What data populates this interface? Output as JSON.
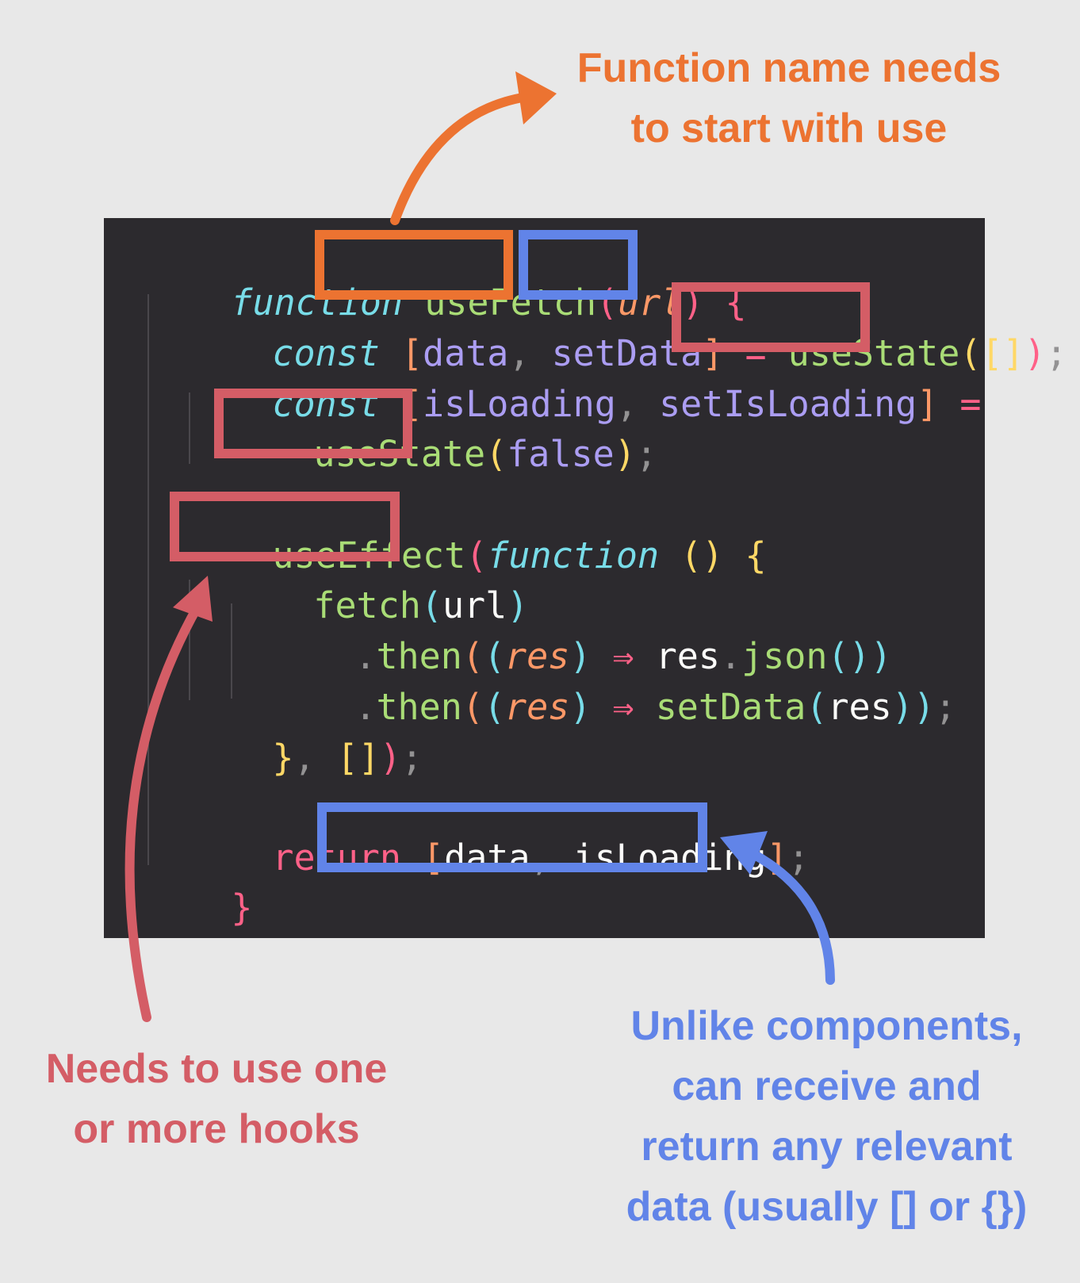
{
  "notes": {
    "function_name": [
      "Function name needs",
      "to start with use"
    ],
    "hooks": [
      "Needs to use one",
      "or more hooks"
    ],
    "return_data": [
      "Unlike components,",
      "can receive and",
      "return any relevant",
      "data (usually [] or {})"
    ]
  },
  "code": {
    "l1": {
      "kw": "function",
      "name": "useFetch",
      "paren_open": "(",
      "param": "url",
      "paren_close": ")",
      "brace": "{"
    },
    "l2": {
      "kw": "const",
      "b1": "[",
      "v1": "data",
      "comma": ",",
      "v2": "setData",
      "b2": "]",
      "eq": "=",
      "hook": "useState",
      "p1": "(",
      "arr": "[]",
      "p2": ")",
      "semi": ";"
    },
    "l3": {
      "kw": "const",
      "b1": "[",
      "v1": "isLoading",
      "comma": ",",
      "v2": "setIsLoading",
      "b2": "]",
      "eq": "="
    },
    "l4": {
      "hook": "useState",
      "p1": "(",
      "val": "false",
      "p2": ")",
      "semi": ";"
    },
    "l5": {
      "hook": "useEffect",
      "p1": "(",
      "kw": "function",
      "parens": "()",
      "brace": "{"
    },
    "l6": {
      "fn": "fetch",
      "p1": "(",
      "arg": "url",
      "p2": ")"
    },
    "l7": {
      "dot": ".",
      "fn": "then",
      "p1": "(",
      "p2": "(",
      "param": "res",
      "p3": ")",
      "arrow": "⇒",
      "obj": "res",
      "dot2": ".",
      "method": "json",
      "p4": "()",
      "p5": ")"
    },
    "l8": {
      "dot": ".",
      "fn": "then",
      "p1": "(",
      "p2": "(",
      "param": "res",
      "p3": ")",
      "arrow": "⇒",
      "fn2": "setData",
      "p4": "(",
      "arg": "res",
      "p5": ")",
      "p6": ")",
      "semi": ";"
    },
    "l9": {
      "brace": "}",
      "comma": ",",
      "arr": "[]",
      "p": ")",
      "semi": ";"
    },
    "l10": {
      "kw": "return",
      "b1": "[",
      "v1": "data",
      "comma": ",",
      "v2": "isLoading",
      "b2": "]",
      "semi": ";"
    },
    "l11": {
      "brace": "}"
    }
  },
  "colors": {
    "orange": "#ec7331",
    "red": "#d45d66",
    "blue": "#6184e8",
    "panel": "#2c2a2e"
  }
}
